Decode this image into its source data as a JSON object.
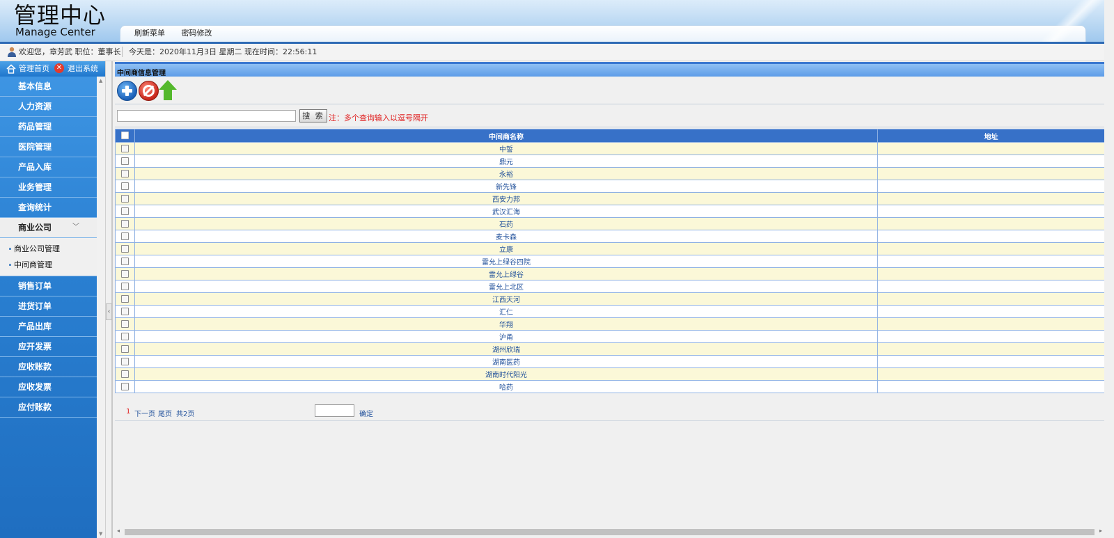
{
  "header": {
    "title_cn": "管理中心",
    "title_en": "Manage Center",
    "menu": [
      "刷新菜单",
      "密码修改"
    ]
  },
  "welcome": {
    "user_text": "欢迎您，章芳武  职位：董事长",
    "date_text": "今天是：2020年11月3日 星期二 现在时间：22:56:11"
  },
  "sidebar": {
    "home": "管理首页",
    "logout": "退出系统",
    "items": [
      "基本信息",
      "人力资源",
      "药品管理",
      "医院管理",
      "产品入库",
      "业务管理",
      "查询统计"
    ],
    "open_item": "商业公司",
    "open_icon": "chevron-down-icon",
    "subitems": [
      "商业公司管理",
      "中间商管理"
    ],
    "items_after": [
      "销售订单",
      "进货订单",
      "产品出库",
      "应开发票",
      "应收账款",
      "应收发票",
      "应付账款"
    ]
  },
  "panel": {
    "title": "中间商信息管理",
    "toolbar_icons": [
      "add-icon",
      "delete-icon",
      "upload-icon"
    ],
    "search_placeholder": "",
    "search_button": "搜 索",
    "search_note": "注：多个查询输入以逗号隔开"
  },
  "table": {
    "columns": [
      "中间商名称",
      "地址"
    ],
    "rows": [
      {
        "name": "中誓",
        "address": ""
      },
      {
        "name": "鼎元",
        "address": ""
      },
      {
        "name": "永裕",
        "address": ""
      },
      {
        "name": "新先锋",
        "address": ""
      },
      {
        "name": "西安力邦",
        "address": ""
      },
      {
        "name": "武汉汇海",
        "address": ""
      },
      {
        "name": "石药",
        "address": ""
      },
      {
        "name": "麦卡森",
        "address": ""
      },
      {
        "name": "立康",
        "address": ""
      },
      {
        "name": "雷允上绿谷四院",
        "address": ""
      },
      {
        "name": "雷允上绿谷",
        "address": ""
      },
      {
        "name": "雷允上北区",
        "address": ""
      },
      {
        "name": "江西天河",
        "address": ""
      },
      {
        "name": "汇仁",
        "address": ""
      },
      {
        "name": "华翔",
        "address": ""
      },
      {
        "name": "沪甬",
        "address": ""
      },
      {
        "name": "湖州欣瑞",
        "address": ""
      },
      {
        "name": "湖南医药",
        "address": ""
      },
      {
        "name": "湖南时代阳光",
        "address": ""
      },
      {
        "name": "哈药",
        "address": ""
      }
    ]
  },
  "pager": {
    "current": "1",
    "next": "下一页",
    "last": "尾页",
    "total": "共2页",
    "confirm": "确定"
  },
  "colors": {
    "accent": "#3771c8",
    "row_alt": "#fbf8d8",
    "sidebar": "#2a80d2",
    "note": "#e02020"
  }
}
